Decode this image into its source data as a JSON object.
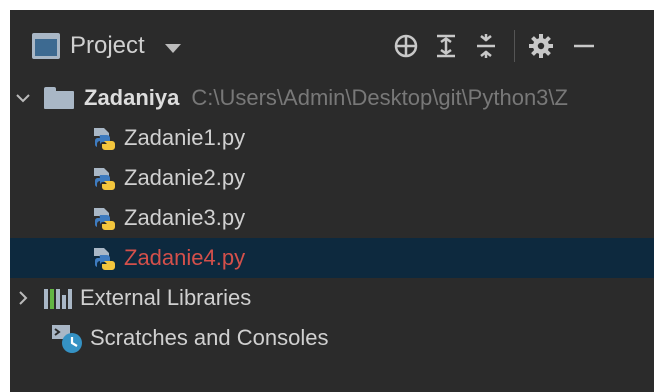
{
  "header": {
    "view_label": "Project",
    "tools": [
      {
        "icon": "locate-icon"
      },
      {
        "icon": "expand-all-icon"
      },
      {
        "icon": "collapse-all-icon"
      },
      {
        "icon": "gear-icon"
      },
      {
        "icon": "minimize-icon"
      }
    ]
  },
  "tree": {
    "root": {
      "name": "Zadaniya",
      "path": "C:\\Users\\Admin\\Desktop\\git\\Python3\\Z"
    },
    "files": [
      {
        "name": "Zadanie1.py",
        "selected": false,
        "modified": false
      },
      {
        "name": "Zadanie2.py",
        "selected": false,
        "modified": false
      },
      {
        "name": "Zadanie3.py",
        "selected": false,
        "modified": false
      },
      {
        "name": "Zadanie4.py",
        "selected": true,
        "modified": true
      }
    ],
    "external_libraries": "External Libraries",
    "scratches": "Scratches and Consoles"
  },
  "colors": {
    "background": "#2b2b2b",
    "selected_row": "#0d293e",
    "modified_file": "#d3504b",
    "path_text": "#787878"
  }
}
